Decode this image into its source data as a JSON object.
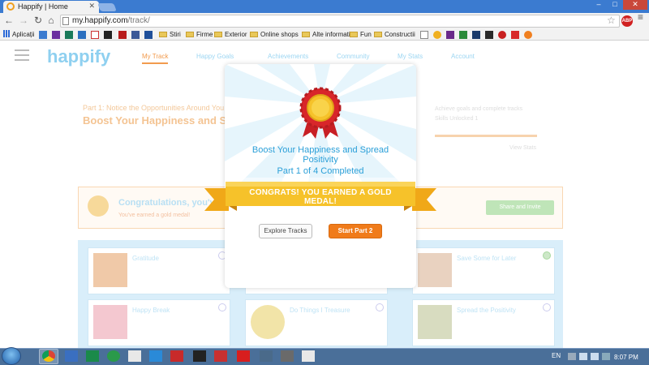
{
  "browser": {
    "tab_title": "Happify | Home",
    "url_host": "my.happify.com",
    "url_path": "/track/",
    "ext_badge": "ABP",
    "window_buttons": [
      "–",
      "□",
      "✕"
    ]
  },
  "bookmarks": {
    "apps_label": "Aplicații",
    "folders": [
      "Stiri",
      "Firme",
      "Exterior",
      "Online shops",
      "Alte informatii",
      "Fun",
      "Constructii"
    ]
  },
  "site": {
    "logo": "happify",
    "nav": [
      "My Track",
      "Happy Goals",
      "Achievements",
      "Community",
      "My Stats",
      "Account"
    ]
  },
  "background": {
    "part_label": "Part 1: Notice the Opportunities Around You",
    "track_title": "Boost Your Happiness and Spread Positivity",
    "side_line1": "Achieve goals and complete tracks",
    "side_line2": "Skills Unlocked 1",
    "side_line3": "View Stats",
    "congrats_title": "Congratulations, you've",
    "congrats_sub": "You've earned a gold medal!",
    "congrats_button": "Share and Invite",
    "cards": [
      {
        "title": "Gratitude"
      },
      {
        "title": ""
      },
      {
        "title": "Save Some for Later"
      },
      {
        "title": "Happy Break"
      },
      {
        "title": "Do Things I Treasure"
      },
      {
        "title": "Spread the Positivity"
      }
    ]
  },
  "modal": {
    "title": "Boost Your Happiness and Spread Positivity",
    "progress": "Part 1 of 4 Completed",
    "banner": "CONGRATS! YOU EARNED A GOLD MEDAL!",
    "explore_label": "Explore Tracks",
    "start_label": "Start Part 2"
  },
  "taskbar": {
    "language": "EN",
    "time": "8:07 PM"
  },
  "colors": {
    "chrome_blue": "#3b7bd0",
    "happify_blue": "#2a9fd8",
    "orange": "#f07b1a",
    "gold": "#f6c22a",
    "medal_red": "#d8262a"
  }
}
